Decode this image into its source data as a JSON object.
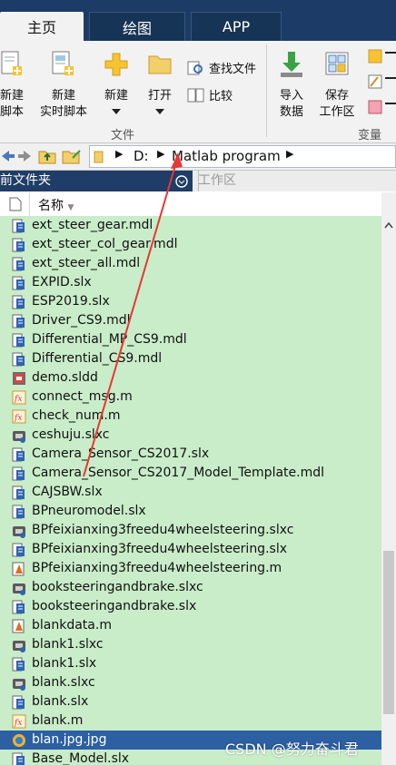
{
  "tabs": [
    "主页",
    "绘图",
    "APP"
  ],
  "ribbon": {
    "new_script": "新建\n脚本",
    "new_live_script": "新建\n实时脚本",
    "new": "新建",
    "open": "打开",
    "find_files": "查找文件",
    "compare": "比较",
    "import_data": "导入\n数据",
    "save_workspace": "保存\n工作区",
    "group_file": "文件",
    "group_variable": "变量"
  },
  "address": {
    "path": [
      "D:",
      "Matlab program"
    ]
  },
  "panel": {
    "current_folder": "当前文件夹",
    "workspace": "工作区"
  },
  "columns": {
    "name": "名称"
  },
  "files": [
    {
      "name": "ext_steer_gear.mdl",
      "icon": "simulink-model-icon"
    },
    {
      "name": "ext_steer_col_gear.mdl",
      "icon": "simulink-model-icon"
    },
    {
      "name": "ext_steer_all.mdl",
      "icon": "simulink-model-icon"
    },
    {
      "name": "EXPID.slx",
      "icon": "simulink-model-icon"
    },
    {
      "name": "ESP2019.slx",
      "icon": "simulink-model-icon"
    },
    {
      "name": "Driver_CS9.mdl",
      "icon": "simulink-model-icon"
    },
    {
      "name": "Differential_MP_CS9.mdl",
      "icon": "simulink-model-icon"
    },
    {
      "name": "Differential_CS9.mdl",
      "icon": "simulink-model-icon"
    },
    {
      "name": "demo.sldd",
      "icon": "data-dictionary-icon"
    },
    {
      "name": "connect_msg.m",
      "icon": "function-file-icon"
    },
    {
      "name": "check_num.m",
      "icon": "function-file-icon"
    },
    {
      "name": "ceshuju.slxc",
      "icon": "cache-file-icon"
    },
    {
      "name": "Camera_Sensor_CS2017.slx",
      "icon": "simulink-model-icon"
    },
    {
      "name": "Camera_Sensor_CS2017_Model_Template.mdl",
      "icon": "simulink-model-icon"
    },
    {
      "name": "CAJSBW.slx",
      "icon": "simulink-model-icon"
    },
    {
      "name": "BPneuromodel.slx",
      "icon": "simulink-model-icon"
    },
    {
      "name": "BPfeixianxing3freedu4wheelsteering.slxc",
      "icon": "cache-file-icon"
    },
    {
      "name": "BPfeixianxing3freedu4wheelsteering.slx",
      "icon": "simulink-model-icon"
    },
    {
      "name": "BPfeixianxing3freedu4wheelsteering.m",
      "icon": "script-file-icon"
    },
    {
      "name": "booksteeringandbrake.slxc",
      "icon": "cache-file-icon"
    },
    {
      "name": "booksteeringandbrake.slx",
      "icon": "simulink-model-icon"
    },
    {
      "name": "blankdata.m",
      "icon": "script-file-icon"
    },
    {
      "name": "blank1.slxc",
      "icon": "cache-file-icon"
    },
    {
      "name": "blank1.slx",
      "icon": "simulink-model-icon"
    },
    {
      "name": "blank.slxc",
      "icon": "cache-file-icon"
    },
    {
      "name": "blank.slx",
      "icon": "simulink-model-icon"
    },
    {
      "name": "blank.m",
      "icon": "function-file-icon"
    },
    {
      "name": "blan.jpg.jpg",
      "icon": "image-file-icon",
      "selected": true
    },
    {
      "name": "Base_Model.slx",
      "icon": "simulink-model-icon"
    }
  ],
  "watermark": "CSDN @努力奋斗君",
  "colors": {
    "title_bar": "#1c3b66",
    "list_bg": "#c9ecc9",
    "selection": "#2d5fa3",
    "arrow": "#e53935"
  }
}
